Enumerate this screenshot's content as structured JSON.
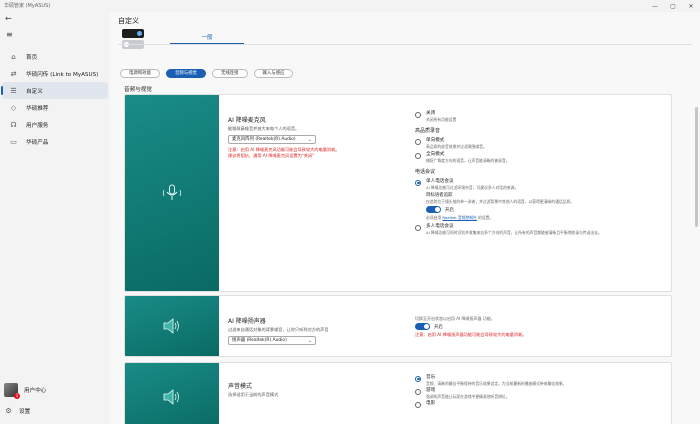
{
  "window": {
    "title": "华硕管家 (MyASUS)",
    "controls": {
      "minimize": "—",
      "maximize": "▢",
      "close": "✕"
    }
  },
  "sidebar": {
    "back_icon": "back-arrow-icon",
    "menu_icon": "hamburger-menu-icon",
    "items": [
      {
        "label": "首页",
        "icon": "home-icon",
        "active": false
      },
      {
        "label": "华硕闪传 (Link to MyASUS)",
        "icon": "link-icon",
        "active": false
      },
      {
        "label": "自定义",
        "icon": "sliders-icon",
        "active": true
      },
      {
        "label": "华硕推荐",
        "icon": "tag-icon",
        "active": false
      },
      {
        "label": "用户服务",
        "icon": "headset-icon",
        "active": false
      },
      {
        "label": "华硕产品",
        "icon": "laptop-icon",
        "active": false
      }
    ],
    "user_center": {
      "label": "用户中心",
      "badge": "1"
    },
    "settings": {
      "label": "设置",
      "icon": "gear-icon"
    }
  },
  "header": {
    "title": "自定义"
  },
  "tabs": {
    "general": "一般"
  },
  "sub_tabs": [
    {
      "label": "电源和效能",
      "active": false
    },
    {
      "label": "音频与视觉",
      "active": true
    },
    {
      "label": "无线连接",
      "active": false
    },
    {
      "label": "输入与感应",
      "active": false
    }
  ],
  "section": {
    "title": "音频与视觉"
  },
  "cards": {
    "mic": {
      "icon": "microphone-waves-icon",
      "title": "AI 降噪麦克风",
      "desc": "能够屏蔽噪音并放大来电个人的语音。",
      "select_value": "麦克风阵列 (Realtek(R) Audio)",
      "warn1": "注意：启用 AI 降噪麦克风功能可能会导致较大的电量消耗。",
      "warn2": "建议将阻抗、通用 AI 降噪麦克风设置为\"关闭\"",
      "right": {
        "off_label": "关闭",
        "off_desc": "关闭所有功能设置",
        "group_heading": "高品质录音",
        "single_label": "单向模式",
        "single_desc": "高品质的收音效果并过滤周围噪音。",
        "omni_label": "全向模式",
        "omni_desc": "捕捉广角度方向的语音，让声音能清晰的被录音。",
        "call_heading": "电话会议",
        "single_call_label": "单人电话会议",
        "single_call_desc": "AI 降噪功能可过滤环境杂音，可建议多人对话的来源。",
        "target_heading": "目标语者追踪",
        "target_desc": "仅追踪位于镜头前的单一讲者，并过滤背景中其他人的语音，以获得更清晰的通话品质。",
        "toggle_label": "开启",
        "link_prefix": "必须启用 ",
        "link_text": "Realtek 音频控制台",
        "link_suffix": " 的设置。",
        "multi_call_label": "多人电话会议",
        "multi_call_desc": "AI 降噪功能可同时识别并收集来自多个方向的声音，让所有的声音都能被清晰且平衡地收录与传送出去。"
      }
    },
    "speaker": {
      "icon": "speaker-waves-icon",
      "title": "AI 降噪扬声器",
      "desc": "过滤来自通话对象的背景噪音，让你只听到对方的声音",
      "select_value": "扬声器 (Realtek(R) Audio)",
      "right_desc": "切换至开启状态以启用 AI 降噪扬声器 功能。",
      "toggle_label": "开启",
      "warn": "注意：启用 AI 降噪扬声器功能可能会导致较大的电量消耗。"
    },
    "sound": {
      "icon": "speaker-waves-icon",
      "title": "声音模式",
      "desc": "选择适用于当前的声音模式",
      "music_label": "音乐",
      "music_desc": "音频、清晰的最佳平衡保持的音乐效果设定，为当前最新的播放模式带来最佳效果。",
      "game_label": "游戏",
      "game_desc": "强调的声音能让玩家在游戏中更精准地听音辨位。",
      "movie_label": "电影"
    }
  }
}
